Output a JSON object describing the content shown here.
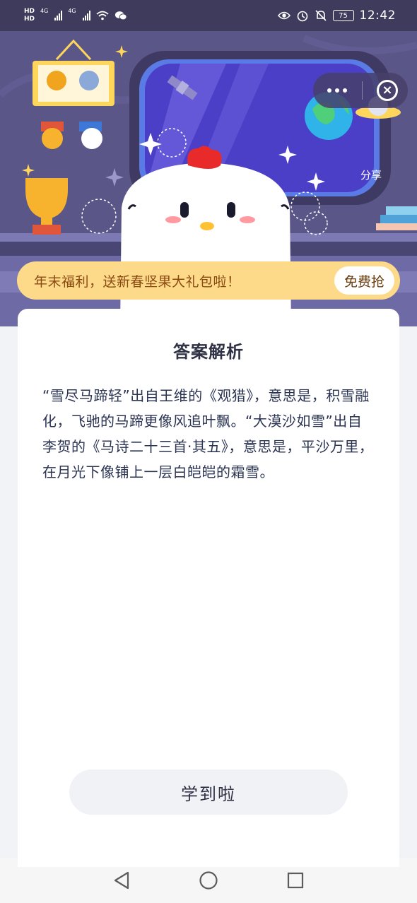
{
  "status_bar": {
    "hd_top": "HD",
    "hd_bottom": "HD",
    "sim1_tag": "4G",
    "sim2_tag": "4G",
    "battery": "75",
    "time": "12:42"
  },
  "header": {
    "share_label": "分享"
  },
  "promo": {
    "text": "年末福利，送新春坚果大礼包啦！",
    "button": "免费抢"
  },
  "card": {
    "title": "答案解析",
    "body": "“雪尽马蹄轻”出自王维的《观猎》，意思是，积雪融化，飞驰的马蹄更像风追叶飘。“大漠沙如雪”出自李贺的《马诗二十三首·其五》，意思是，平沙万里，在月光下像铺上一层白皑皑的霜雪。",
    "button": "学到啦"
  },
  "colors": {
    "hero_bg": "#5b5787",
    "promo_bg": "#fdd98a",
    "promo_text": "#8a4a12",
    "body_text": "#2a3352"
  }
}
